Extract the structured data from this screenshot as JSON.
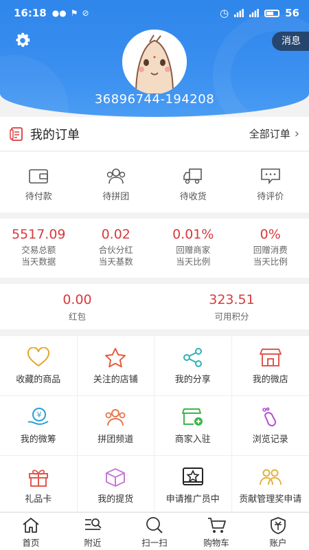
{
  "status_bar": {
    "time": "16:18",
    "battery": "56"
  },
  "header": {
    "message_label": "消息",
    "user_id": "36896744-194208"
  },
  "orders": {
    "title": "我的订单",
    "all_label": "全部订单",
    "statuses": [
      {
        "label": "待付款",
        "icon": "wallet-icon"
      },
      {
        "label": "待拼团",
        "icon": "group-icon"
      },
      {
        "label": "待收货",
        "icon": "truck-icon"
      },
      {
        "label": "待评价",
        "icon": "comment-icon"
      }
    ]
  },
  "stats": [
    {
      "value": "5517.09",
      "label1": "交易总额",
      "label2": "当天数据"
    },
    {
      "value": "0.02",
      "label1": "合伙分红",
      "label2": "当天基数"
    },
    {
      "value": "0.01%",
      "label1": "回赠商家",
      "label2": "当天比例"
    },
    {
      "value": "0%",
      "label1": "回赠消费",
      "label2": "当天比例"
    }
  ],
  "wallet": [
    {
      "value": "0.00",
      "label": "红包"
    },
    {
      "value": "323.51",
      "label": "可用积分"
    }
  ],
  "grid": [
    {
      "label": "收藏的商品",
      "icon": "heart-icon",
      "color": "#e3a52b"
    },
    {
      "label": "关注的店铺",
      "icon": "star-icon",
      "color": "#e8593a"
    },
    {
      "label": "我的分享",
      "icon": "share-icon",
      "color": "#2ab2b8"
    },
    {
      "label": "我的微店",
      "icon": "shop-icon",
      "color": "#e2574c"
    },
    {
      "label": "我的微筹",
      "icon": "yuan-hand-icon",
      "color": "#2a9fd8"
    },
    {
      "label": "拼团频道",
      "icon": "group-icon",
      "color": "#e8744a"
    },
    {
      "label": "商家入驻",
      "icon": "store-plus-icon",
      "color": "#3bb54a"
    },
    {
      "label": "浏览记录",
      "icon": "footprint-icon",
      "color": "#b64bd6"
    },
    {
      "label": "礼品卡",
      "icon": "gift-icon",
      "color": "#e2574c"
    },
    {
      "label": "我的提货",
      "icon": "box-icon",
      "color": "#c37ad8"
    },
    {
      "label": "申请推广员中",
      "icon": "badge-star-icon",
      "color": "#222222"
    },
    {
      "label": "贡献管理奖申请",
      "icon": "team-icon",
      "color": "#e3b041"
    }
  ],
  "tabbar": [
    {
      "label": "首页",
      "icon": "home-icon"
    },
    {
      "label": "附近",
      "icon": "nearby-icon"
    },
    {
      "label": "扫一扫",
      "icon": "scan-icon"
    },
    {
      "label": "购物车",
      "icon": "cart-icon"
    },
    {
      "label": "账户",
      "icon": "account-icon"
    }
  ]
}
